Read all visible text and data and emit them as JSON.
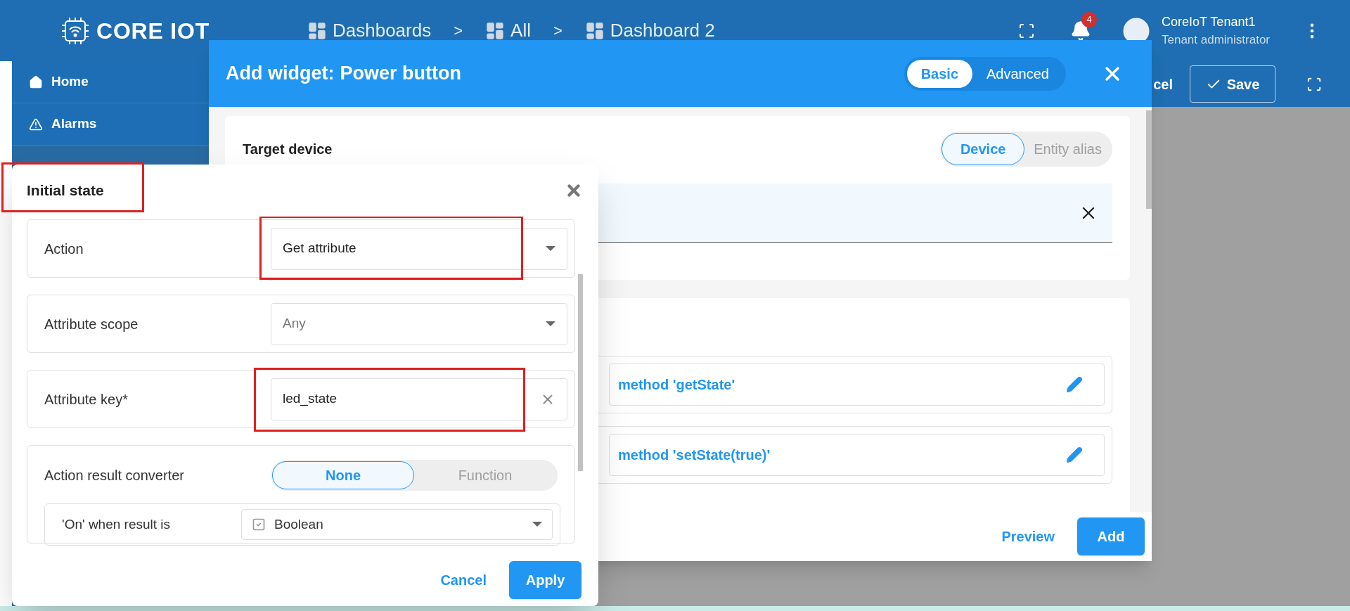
{
  "app": {
    "logo": "CORE IOT"
  },
  "breadcrumb": [
    {
      "label": "Dashboards",
      "separator": ">"
    },
    {
      "label": "All",
      "separator": ">"
    },
    {
      "label": "Dashboard 2"
    }
  ],
  "notifications": {
    "count": "4"
  },
  "user": {
    "name": "CoreIoT Tenant1",
    "role": "Tenant administrator"
  },
  "sidebar": {
    "items": [
      {
        "label": "Home"
      },
      {
        "label": "Alarms"
      }
    ]
  },
  "toolbar": {
    "buttons": [
      {
        "label": "cel",
        "kind": "text"
      },
      {
        "label": "Save",
        "kind": "outlined"
      }
    ]
  },
  "widget_dialog": {
    "title": "Add widget:",
    "widget_name": "Power button",
    "modes": [
      {
        "label": "Basic",
        "selected": true
      },
      {
        "label": "Advanced",
        "selected": false
      }
    ],
    "target": {
      "title": "Target device",
      "sources": [
        {
          "label": "Device",
          "selected": true
        },
        {
          "label": "Entity alias",
          "selected": false
        }
      ]
    },
    "actions": [
      {
        "label": "method 'getState'"
      },
      {
        "label": "method 'setState(true)'"
      }
    ],
    "buttons": [
      {
        "label": "Preview",
        "kind": "text"
      },
      {
        "label": "Add",
        "kind": "primary"
      }
    ]
  },
  "initial_state_dialog": {
    "title": "Initial state",
    "title_highlighted": true,
    "fields": [
      {
        "label": "Action",
        "kind": "select",
        "value": "Get attribute",
        "highlighted": true
      },
      {
        "label": "Attribute scope",
        "kind": "select",
        "placeholder": "Any",
        "highlighted": false
      },
      {
        "label": "Attribute key*",
        "kind": "text",
        "value": "led_state",
        "highlighted": true
      }
    ],
    "converter": {
      "label": "Action result converter",
      "options": [
        {
          "label": "None",
          "selected": true
        },
        {
          "label": "Function",
          "selected": false
        }
      ],
      "on_when": {
        "label": "'On' when result is",
        "value": "Boolean"
      }
    },
    "buttons": [
      {
        "label": "Cancel",
        "kind": "text"
      },
      {
        "label": "Apply",
        "kind": "primary"
      }
    ]
  }
}
